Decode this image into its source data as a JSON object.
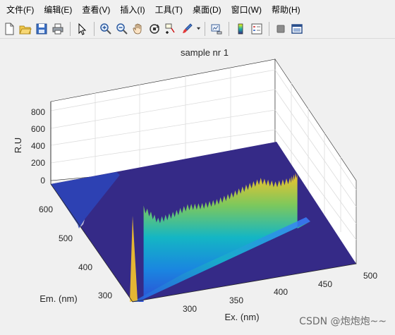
{
  "menu": [
    {
      "label": "文件(F)"
    },
    {
      "label": "编辑(E)"
    },
    {
      "label": "查看(V)"
    },
    {
      "label": "插入(I)"
    },
    {
      "label": "工具(T)"
    },
    {
      "label": "桌面(D)"
    },
    {
      "label": "窗口(W)"
    },
    {
      "label": "帮助(H)"
    }
  ],
  "toolbar_icons": [
    "new-figure-icon",
    "open-file-icon",
    "save-icon",
    "print-icon",
    "pointer-icon",
    "zoom-in-icon",
    "zoom-out-icon",
    "pan-icon",
    "rotate-3d-icon",
    "data-cursor-icon",
    "brush-icon",
    "link-plot-icon",
    "colorbar-icon",
    "legend-icon",
    "hide-plot-tools-icon",
    "show-plot-tools-icon"
  ],
  "chart_data": {
    "type": "surface",
    "title": "sample nr 1",
    "xlabel": "Ex. (nm)",
    "ylabel": "Em. (nm)",
    "zlabel": "R.U",
    "x_ticks": [
      "300",
      "350",
      "400",
      "450",
      "500"
    ],
    "y_ticks": [
      "300",
      "400",
      "500",
      "600"
    ],
    "z_ticks": [
      "0",
      "200",
      "400",
      "600",
      "800"
    ],
    "xlim": [
      265,
      500
    ],
    "ylim": [
      250,
      700
    ],
    "zlim": [
      0,
      900
    ],
    "ridge": {
      "description_points_ex": [
        280,
        300,
        320,
        340,
        360,
        380,
        400,
        420,
        440,
        460,
        480,
        490
      ],
      "peak_ru": [
        520,
        360,
        390,
        440,
        420,
        430,
        470,
        520,
        560,
        490,
        500,
        550
      ]
    },
    "colormap": "parula",
    "grid": true
  },
  "watermark": "CSDN @炮炮炮~~"
}
